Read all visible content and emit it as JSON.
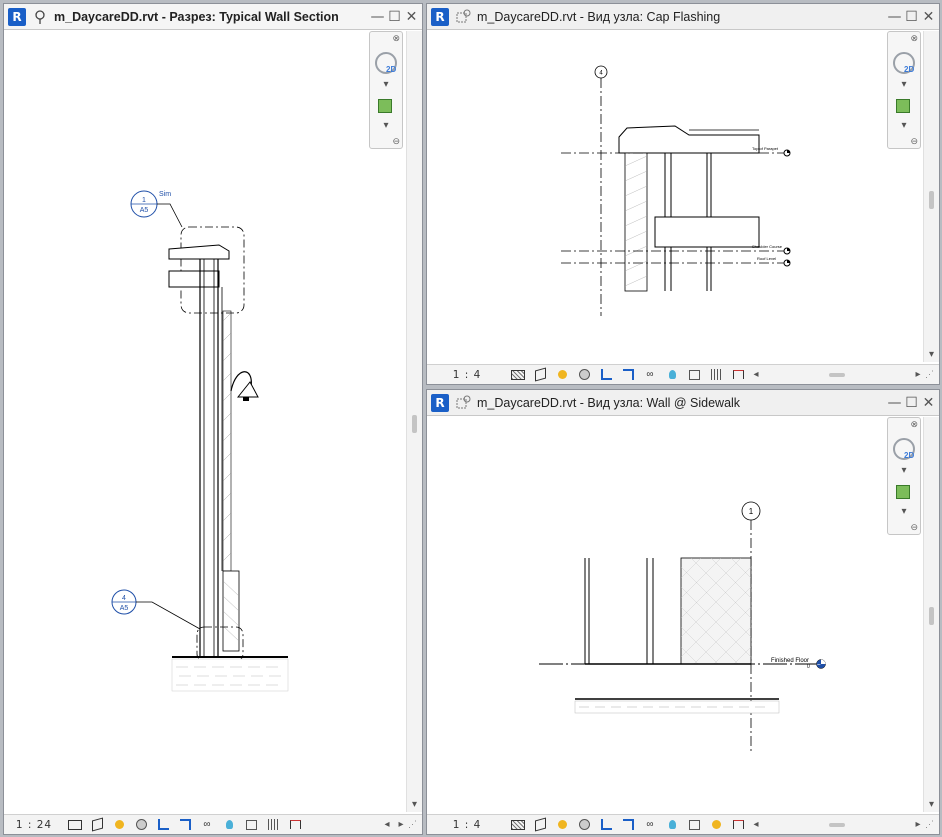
{
  "windows": {
    "left": {
      "app_icon": "R",
      "view_type_icon": "section-icon",
      "title": "m_DaycareDD.rvt - Разрез: Typical Wall Section",
      "scale": "1 : 24",
      "callout_top": {
        "number": "1",
        "sheet": "A5",
        "note": "Sim"
      },
      "callout_bottom": {
        "number": "4",
        "sheet": "A5"
      }
    },
    "top_right": {
      "app_icon": "R",
      "view_type_icon": "detail-view-icon",
      "title": "m_DaycareDD.rvt - Вид узла: Cap Flashing",
      "scale": "1 : 4",
      "grid_bubble": "4",
      "level_labels": [
        "Top of Parapet",
        "Shoulder Course",
        "Roof Level"
      ]
    },
    "bottom_right": {
      "app_icon": "R",
      "view_type_icon": "detail-view-icon",
      "title": "m_DaycareDD.rvt - Вид узла: Wall @ Sidewalk",
      "scale": "1 : 4",
      "grid_bubble": "1",
      "level_label": "Finished Floor",
      "level_value": "0"
    }
  },
  "window_controls": {
    "minimize": "—",
    "restore": "☐",
    "close": "✕"
  },
  "statusbar_icons": [
    "detail-level-icon",
    "visual-style-icon",
    "sun-path-icon",
    "shadows-icon",
    "crop-view-icon",
    "show-crop-icon",
    "temporary-hide-icon",
    "reveal-hidden-icon",
    "worksharing-icon",
    "analytical-model-icon",
    "highlight-displacement-icon",
    "reveal-constraints-icon"
  ],
  "navbar": {
    "wheel_label": "2D",
    "zoom_icon": "zoom-region-icon"
  },
  "colors": {
    "revit_blue": "#1a5fc7",
    "annotation_blue": "#1f4fa8",
    "background": "#b8bcc2"
  }
}
